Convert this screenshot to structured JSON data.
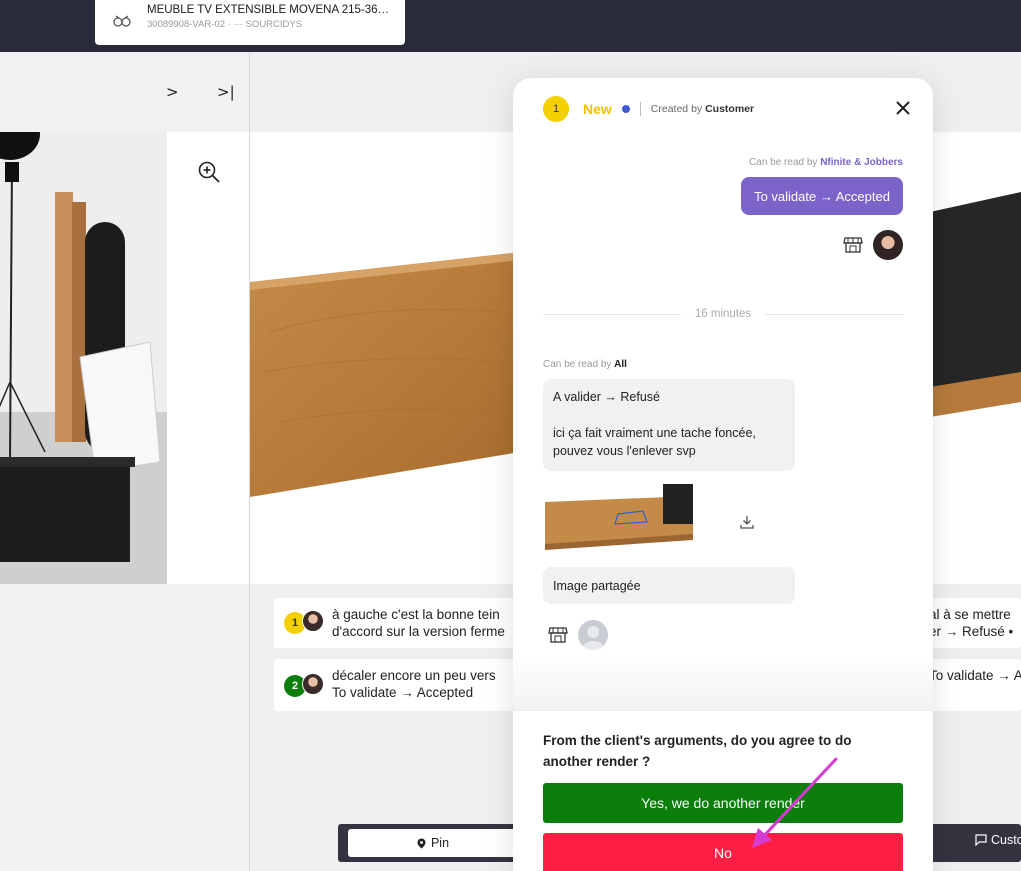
{
  "product": {
    "title": "MEUBLE TV EXTENSIBLE MOVENA 215-360C...",
    "reference": "30089908-VAR-02",
    "bullet": "·",
    "supplier_prefix": "···",
    "supplier": "SOURCIDYS"
  },
  "nav": {
    "next": ">",
    "last": ">|"
  },
  "comments": [
    {
      "number": "1",
      "color": "#f5d000",
      "line1": "à gauche c'est la bonne tein",
      "line2": "d'accord sur la version ferme",
      "right_line1": "al à se mettre",
      "right_line2": "er → Refusé •"
    },
    {
      "number": "2",
      "color": "#0a7d0a",
      "line1": "décaler encore un peu vers",
      "line2": "To validate → Accepted",
      "right_line1": "To validate → A",
      "right_line2": ""
    }
  ],
  "toolbar": {
    "pin_label": "Pin",
    "customer_label": "Custo"
  },
  "modal": {
    "number": "1",
    "status": "New",
    "created_prefix": "Created by",
    "created_by": "Customer",
    "msg1": {
      "can_read_prefix": "Can be read by",
      "can_read": "Nfinite & Jobbers",
      "text": "To validate → Accepted"
    },
    "time_separator": "16 minutes",
    "msg2": {
      "can_read_prefix": "Can be read by",
      "can_read": "All",
      "line1": "A valider → Refusé",
      "line2": "ici ça fait vraiment une tache foncée,",
      "line3": "pouvez vous l'enlever svp",
      "shared_label": "Image partagée"
    },
    "question": "From the client's arguments, do you agree to do another render ?",
    "yes_label": "Yes, we do another render",
    "no_label": "No"
  },
  "colors": {
    "topbar": "#2a2b3a",
    "status_new": "#f2c200",
    "purple_bubble": "#7b63c9",
    "yes_green": "#0a7d0a",
    "no_red": "#ff1f44",
    "annotation_arrow": "#d63bd1"
  }
}
